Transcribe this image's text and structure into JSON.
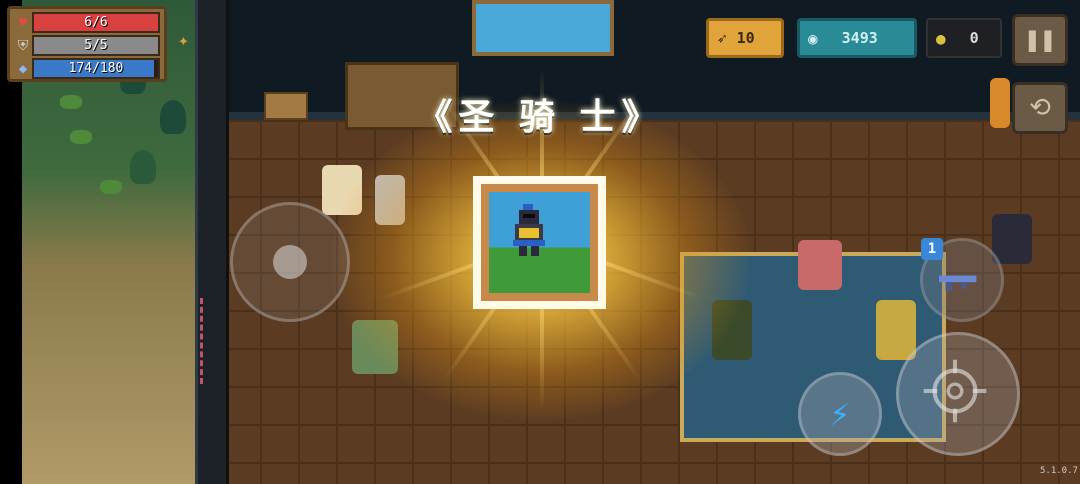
{
  "hud": {
    "hp": {
      "label": "6/6",
      "icon": "heart-icon",
      "fraction": 1.0,
      "color": "#d94040"
    },
    "armor": {
      "label": "5/5",
      "icon": "shield-icon",
      "fraction": 1.0,
      "color": "#8a8a8a"
    },
    "energy": {
      "label": "174/180",
      "icon": "diamond-icon",
      "fraction": 0.967,
      "color": "#3a78c8"
    }
  },
  "currencies": {
    "fish": {
      "value": "10",
      "icon": "fish-icon",
      "color": "#e0a43a"
    },
    "gems": {
      "value": "3493",
      "icon": "gem-icon",
      "color": "#2a8a96"
    },
    "coins": {
      "value": "0",
      "icon": "coin-icon",
      "color": "#d8c040"
    }
  },
  "buttons": {
    "pause": {
      "icon": "pause-icon",
      "glyph": "❚❚"
    },
    "swap": {
      "icon": "swap-character-icon",
      "glyph": "⟲"
    },
    "skill": {
      "icon": "lightning-icon",
      "glyph": "⚡"
    },
    "attack": {
      "icon": "crosshair-icon"
    },
    "weapon_switch": {
      "icon": "gun-icon",
      "slot_number": "1"
    }
  },
  "unlock": {
    "title": "《圣 骑 士》",
    "portrait_icon": "paladin-portrait-icon"
  },
  "version": "5.1.0.7"
}
